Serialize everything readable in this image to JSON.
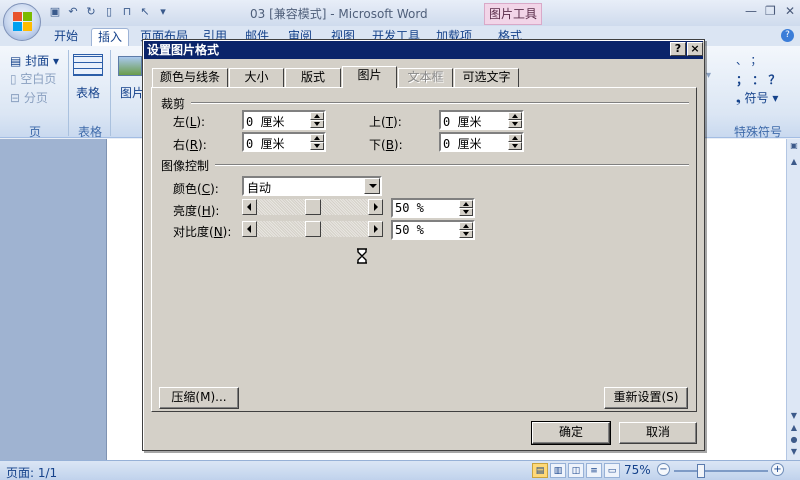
{
  "window": {
    "title": "03 [兼容模式] - Microsoft Word",
    "context_tab": "图片工具",
    "min": "—",
    "restore": "❐",
    "close": "✕"
  },
  "ribbon_tabs": [
    "开始",
    "插入",
    "页面布局",
    "引用",
    "邮件",
    "审阅",
    "视图",
    "开发工具",
    "加载项",
    "格式"
  ],
  "ribbon": {
    "cover": "封面",
    "blank_page": "空白页",
    "page_break": "分页",
    "table": "表格",
    "picture": "图片",
    "group_page": "页",
    "group_table": "表格",
    "group_special": "特殊符号",
    "symbol": "符号",
    "sym_row1": "、 ；",
    "sym_row2": "； ： ？",
    "colon_row": "， 。"
  },
  "dialog": {
    "title": "设置图片格式",
    "help_btn": "?",
    "close_btn": "×",
    "tabs": [
      "颜色与线条",
      "大小",
      "版式",
      "图片",
      "文本框",
      "可选文字"
    ],
    "crop": {
      "section": "裁剪",
      "left_label": "左(",
      "left_key": "L",
      "left_value": "0 厘米",
      "top_label": "上(",
      "top_key": "T",
      "top_value": "0 厘米",
      "right_label": "右(",
      "right_key": "R",
      "right_value": "0 厘米",
      "bottom_label": "下(",
      "bottom_key": "B",
      "bottom_value": "0 厘米",
      "suffix": "):"
    },
    "image_control": {
      "section": "图像控制",
      "color_label": "颜色(",
      "color_key": "C",
      "color_value": "自动",
      "brightness_label": "亮度(",
      "brightness_key": "H",
      "brightness_value": "50 %",
      "contrast_label": "对比度(",
      "contrast_key": "N",
      "contrast_value": "50 %",
      "brightness_level": 0.5,
      "contrast_level": 0.5
    },
    "compress_btn": "压缩(M)...",
    "reset_btn": "重新设置(S)",
    "ok_btn": "确定",
    "cancel_btn": "取消"
  },
  "status": {
    "page": "页面: 1/1",
    "zoom": "75%",
    "zoom_level": 0.75
  }
}
